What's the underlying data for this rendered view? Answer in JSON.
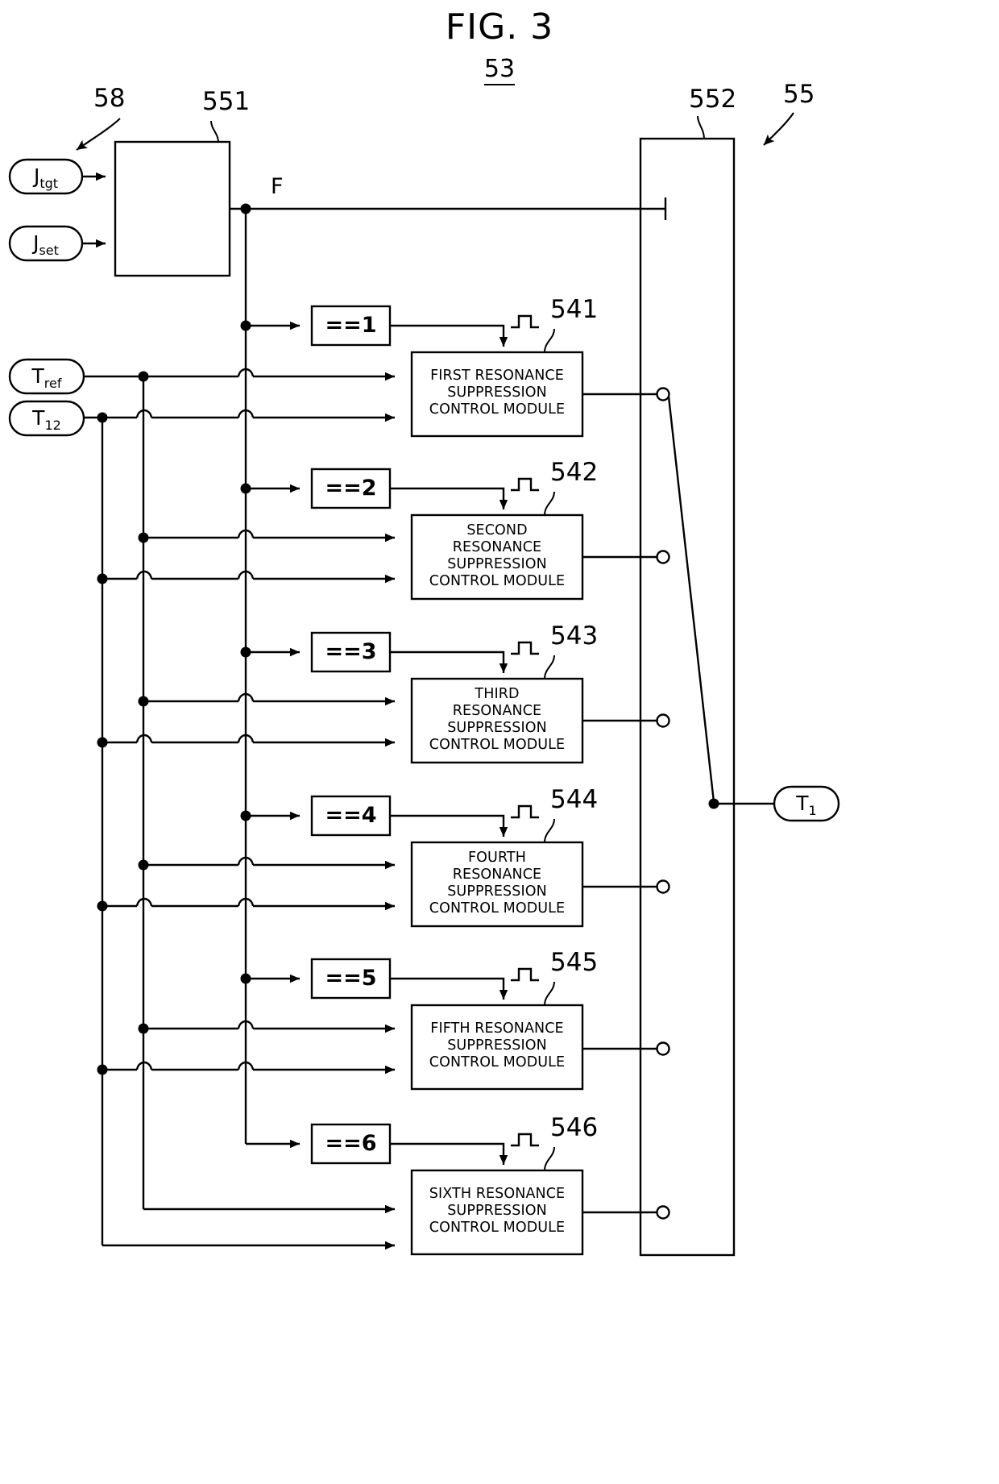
{
  "figure": {
    "title": "FIG. 3",
    "subtitle": "53"
  },
  "reference_numerals": {
    "n58": "58",
    "n551": "551",
    "n552": "552",
    "n55": "55",
    "n541": "541",
    "n542": "542",
    "n543": "543",
    "n544": "544",
    "n545": "545",
    "n546": "546"
  },
  "signals": {
    "j_tgt": "J",
    "j_tgt_sub": "tgt",
    "j_set": "J",
    "j_set_sub": "set",
    "t_ref": "T",
    "t_ref_sub": "ref",
    "t_12": "T",
    "t_12_sub": "12",
    "t_out": "T",
    "t_out_sub": "1",
    "f_label": "F"
  },
  "comparators": [
    {
      "label": "==1"
    },
    {
      "label": "==2"
    },
    {
      "label": "==3"
    },
    {
      "label": "==4"
    },
    {
      "label": "==5"
    },
    {
      "label": "==6"
    }
  ],
  "modules": [
    {
      "lines": [
        "FIRST RESONANCE",
        "SUPPRESSION",
        "CONTROL MODULE"
      ]
    },
    {
      "lines": [
        "SECOND",
        "RESONANCE",
        "SUPPRESSION",
        "CONTROL MODULE"
      ]
    },
    {
      "lines": [
        "THIRD",
        "RESONANCE",
        "SUPPRESSION",
        "CONTROL MODULE"
      ]
    },
    {
      "lines": [
        "FOURTH",
        "RESONANCE",
        "SUPPRESSION",
        "CONTROL MODULE"
      ]
    },
    {
      "lines": [
        "FIFTH RESONANCE",
        "SUPPRESSION",
        "CONTROL MODULE"
      ]
    },
    {
      "lines": [
        "SIXTH RESONANCE",
        "SUPPRESSION",
        "CONTROL MODULE"
      ]
    }
  ],
  "module_text": {
    "m1l1": "FIRST RESONANCE",
    "m1l2": "SUPPRESSION",
    "m1l3": "CONTROL MODULE",
    "m2l1": "SECOND",
    "m2l2": "RESONANCE",
    "m2l3": "SUPPRESSION",
    "m2l4": "CONTROL MODULE",
    "m3l1": "THIRD",
    "m3l2": "RESONANCE",
    "m3l3": "SUPPRESSION",
    "m3l4": "CONTROL MODULE",
    "m4l1": "FOURTH",
    "m4l2": "RESONANCE",
    "m4l3": "SUPPRESSION",
    "m4l4": "CONTROL MODULE",
    "m5l1": "FIFTH RESONANCE",
    "m5l2": "SUPPRESSION",
    "m5l3": "CONTROL MODULE",
    "m6l1": "SIXTH RESONANCE",
    "m6l2": "SUPPRESSION",
    "m6l3": "CONTROL MODULE"
  },
  "comparator_text": {
    "c1": "==1",
    "c2": "==2",
    "c3": "==3",
    "c4": "==4",
    "c5": "==5",
    "c6": "==6"
  },
  "colors": {
    "line": "#000000",
    "background": "#ffffff"
  }
}
